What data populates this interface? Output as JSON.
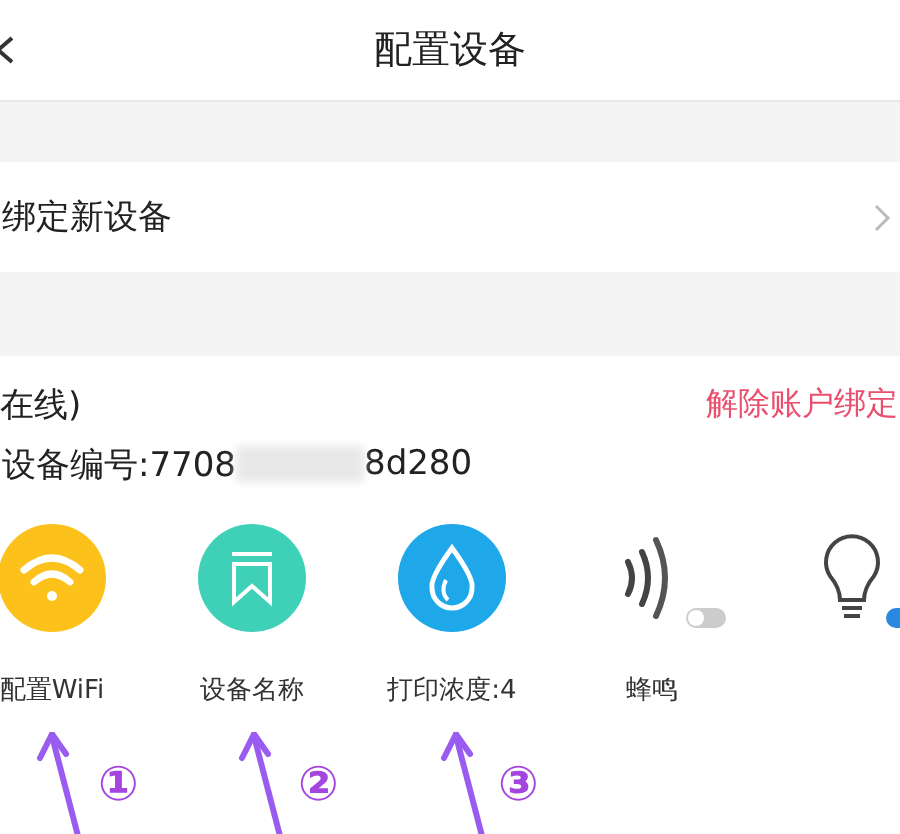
{
  "header": {
    "title": "配置设备"
  },
  "bind_row": {
    "label": "绑定新设备"
  },
  "device": {
    "status": "在线)",
    "unbind": "解除账户绑定",
    "serial_prefix": "设备编号:7708",
    "serial_suffix": "8d280"
  },
  "functions": [
    {
      "kind": "wifi",
      "label": "配置WiFi"
    },
    {
      "kind": "name",
      "label": "设备名称"
    },
    {
      "kind": "density",
      "label": "打印浓度:4"
    },
    {
      "kind": "buzzer",
      "label": "蜂鸣",
      "on": false
    },
    {
      "kind": "light",
      "on": true
    }
  ],
  "annotations": [
    "①",
    "②",
    "③"
  ]
}
